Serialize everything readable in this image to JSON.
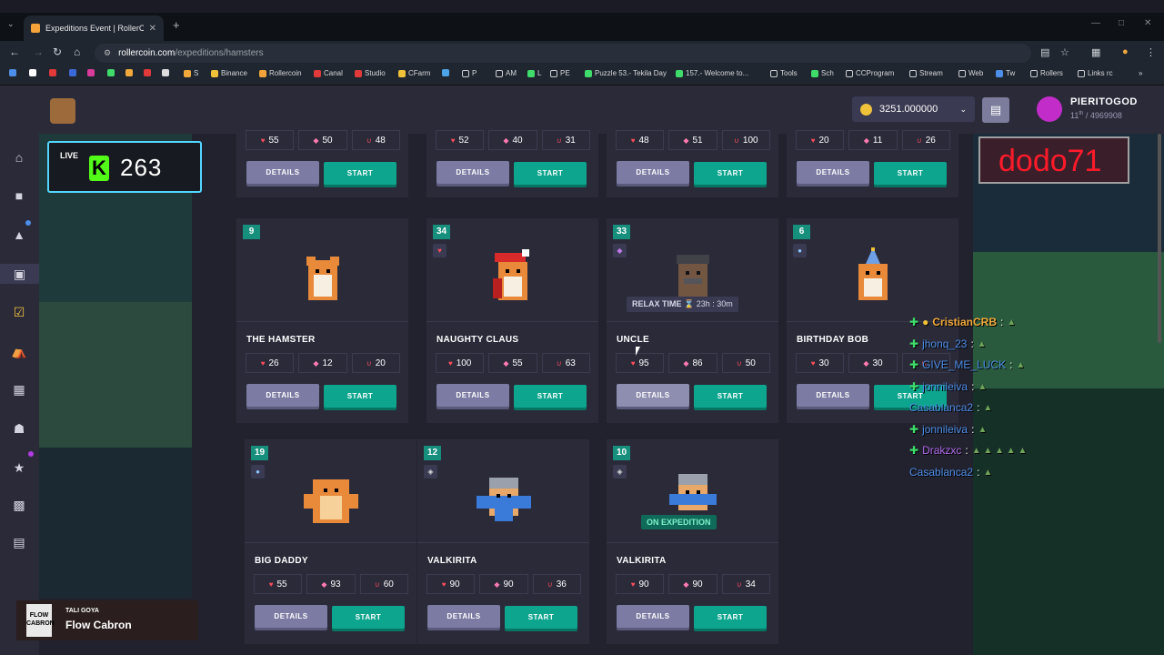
{
  "browser": {
    "tab_title": "Expeditions Event | RollerCoin",
    "url_domain": "rollercoin.com",
    "url_path": "/expeditions/hamsters",
    "bookmarks": [
      "S",
      "Binance",
      "Rollercoin",
      "Canal",
      "Studio",
      "CFarm",
      "P",
      "AM",
      "L",
      "PE",
      "Puzzle 53.- Tekila Day",
      "157.- Welcome to...",
      "Tools",
      "Sch",
      "CCProgram",
      "Stream",
      "Web",
      "Tw",
      "Rollers",
      "Links rc"
    ]
  },
  "header": {
    "balance": "3251.000000",
    "username": "PIERITOGOD",
    "rank_num": "11",
    "rank_suffix": "th",
    "rank_total": "/ 4969908"
  },
  "live": {
    "label": "LIVE",
    "count": "263"
  },
  "stream_overlay": {
    "text": "dodo71"
  },
  "buttons": {
    "details": "DETAILS",
    "start": "START"
  },
  "top_row": [
    {
      "stats": [
        "55",
        "50",
        "48"
      ]
    },
    {
      "stats": [
        "52",
        "40",
        "31"
      ]
    },
    {
      "stats": [
        "48",
        "51",
        "100"
      ]
    },
    {
      "stats": [
        "20",
        "11",
        "26"
      ]
    }
  ],
  "cards": [
    {
      "level": "9",
      "name": "THE HAMSTER",
      "stats": [
        "26",
        "12",
        "20"
      ],
      "badge": "",
      "status": ""
    },
    {
      "level": "34",
      "name": "NAUGHTY CLAUS",
      "stats": [
        "100",
        "55",
        "63"
      ],
      "badge": "heart",
      "status": ""
    },
    {
      "level": "33",
      "name": "UNCLE",
      "stats": [
        "95",
        "86",
        "50"
      ],
      "badge": "gem",
      "status": "RELAX TIME",
      "timer": "23h : 30m"
    },
    {
      "level": "6",
      "name": "BIRTHDAY BOB",
      "stats": [
        "30",
        "30",
        ""
      ],
      "badge": "drop",
      "status": ""
    },
    {
      "level": "19",
      "name": "BIG DADDY",
      "stats": [
        "55",
        "93",
        "60"
      ],
      "badge": "drop",
      "status": ""
    },
    {
      "level": "12",
      "name": "VALKIRITA",
      "stats": [
        "90",
        "90",
        "36"
      ],
      "badge": "leaf",
      "status": ""
    },
    {
      "level": "10",
      "name": "VALKIRITA",
      "stats": [
        "90",
        "90",
        "34"
      ],
      "badge": "leaf",
      "status": "ON EXPEDITION"
    }
  ],
  "chat": [
    {
      "user": "CristianCRB",
      "color": "#f2a93b",
      "emotes": 1
    },
    {
      "user": "jhonq_23",
      "color": "#4d8fe8",
      "emotes": 1
    },
    {
      "user": "GIVE_ME_LUCK",
      "color": "#4d8fe8",
      "emotes": 1
    },
    {
      "user": "jonnileiva",
      "color": "#4d8fe8",
      "emotes": 1
    },
    {
      "user": "Casablanca2",
      "color": "#4d8fe8",
      "emotes": 1
    },
    {
      "user": "jonnileiva",
      "color": "#4d8fe8",
      "emotes": 1
    },
    {
      "user": "Drakzxc",
      "color": "#b06ae8",
      "emotes": 5
    },
    {
      "user": "Casablanca2",
      "color": "#4d8fe8",
      "emotes": 1
    }
  ],
  "now_playing": {
    "title": "TALI GOYA",
    "artist": "Flow Cabron",
    "cover": "FLOW CABRON"
  }
}
